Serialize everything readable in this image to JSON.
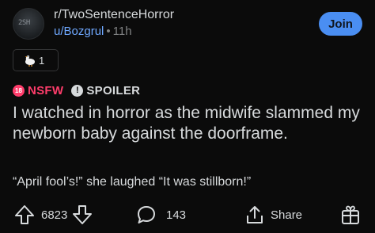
{
  "header": {
    "subreddit": "r/TwoSentenceHorror",
    "user": "u/Bozgrul",
    "separator": "•",
    "time": "11h",
    "join_label": "Join",
    "avatar_icon": "subreddit-avatar"
  },
  "award": {
    "icon": "goose-icon",
    "count": "1"
  },
  "tags": {
    "nsfw_label": "NSFW",
    "nsfw_icon_text": "18",
    "spoiler_label": "SPOILER",
    "spoiler_icon_text": "!",
    "nsfw_color": "#ff3d6b"
  },
  "post": {
    "title": "I watched in horror as the midwife slammed my newborn baby against the doorframe.",
    "body": "“April fool’s!” she laughed “It was stillborn!”"
  },
  "actions": {
    "upvotes": "6823",
    "comments": "143",
    "share_label": "Share",
    "icons": [
      "upvote-icon",
      "downvote-icon",
      "comment-icon",
      "share-icon",
      "award-add-icon"
    ]
  },
  "colors": {
    "background": "#0b0b0b",
    "text": "#d7dadc",
    "link": "#6fa8ff",
    "join_button": "#4a8ef2"
  }
}
